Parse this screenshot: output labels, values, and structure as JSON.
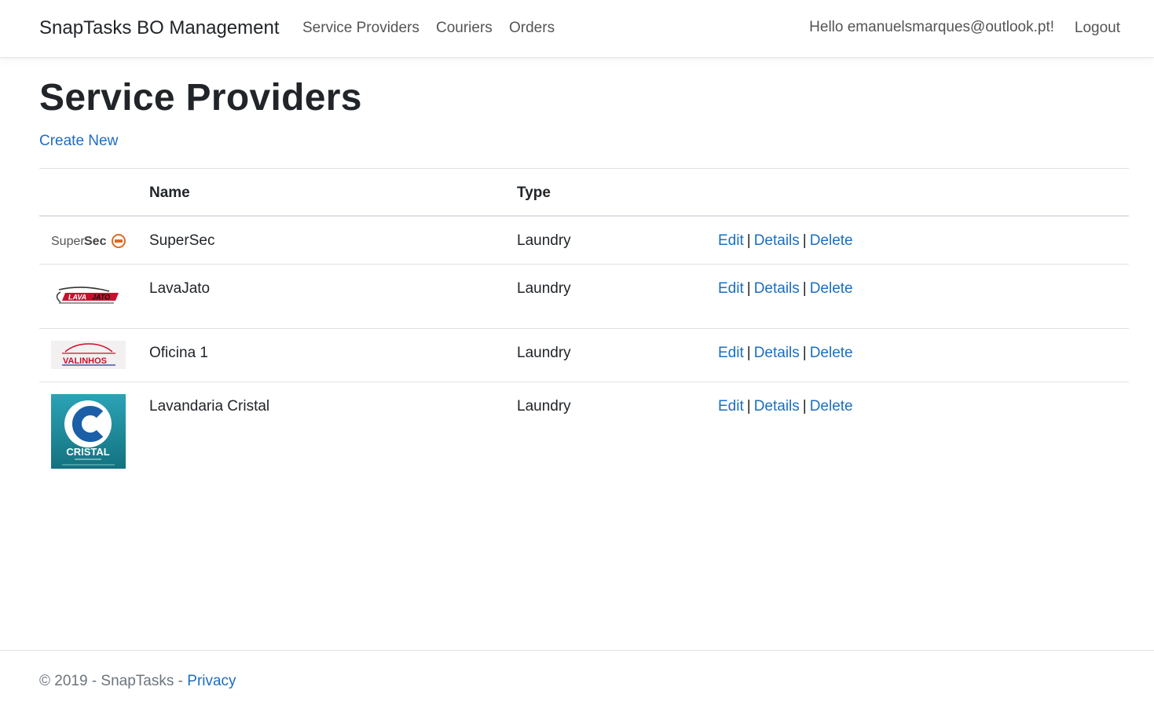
{
  "nav": {
    "brand": "SnapTasks BO Management",
    "links": [
      "Service Providers",
      "Couriers",
      "Orders"
    ],
    "greeting": "Hello emanuelsmarques@outlook.pt!",
    "logout": "Logout"
  },
  "page": {
    "title": "Service Providers",
    "create_new": "Create New"
  },
  "table": {
    "columns": [
      "",
      "Name",
      "Type",
      ""
    ],
    "rows": [
      {
        "logo": "supersec-logo",
        "logo_text": "SuperSec",
        "name": "SuperSec",
        "type": "Laundry",
        "actions": [
          "Edit",
          "Details",
          "Delete"
        ]
      },
      {
        "logo": "lavajato-logo",
        "logo_text": "LAVAJATO",
        "name": "LavaJato",
        "type": "Laundry",
        "actions": [
          "Edit",
          "Details",
          "Delete"
        ]
      },
      {
        "logo": "oficina-valinhos-logo",
        "logo_text": "VALINHOS",
        "name": "Oficina 1",
        "type": "Laundry",
        "actions": [
          "Edit",
          "Details",
          "Delete"
        ]
      },
      {
        "logo": "cristal-logo",
        "logo_text": "CRISTAL",
        "name": "Lavandaria Cristal",
        "type": "Laundry",
        "actions": [
          "Edit",
          "Details",
          "Delete"
        ]
      }
    ],
    "separator": "|"
  },
  "footer": {
    "copyright": "© 2019 - SnapTasks - ",
    "privacy": "Privacy"
  },
  "colors": {
    "link": "#1b6ec2",
    "text": "#212529",
    "nav_text": "#545454",
    "border": "#dee2e6",
    "muted": "#6c757d"
  }
}
